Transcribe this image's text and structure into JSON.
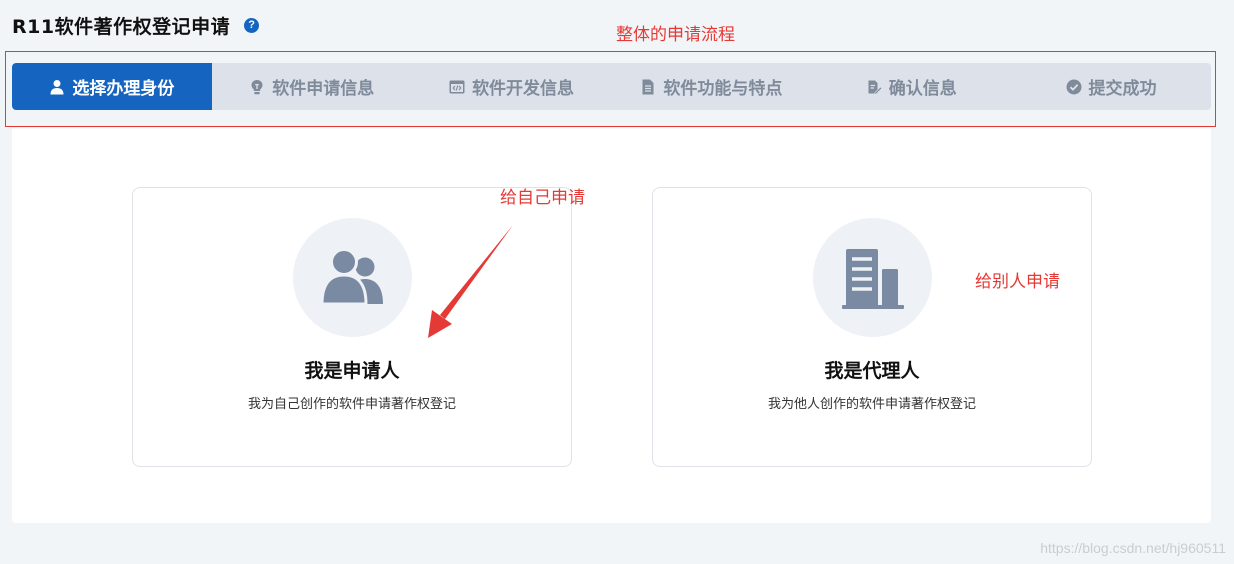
{
  "header": {
    "title": "R11软件著作权登记申请",
    "help_icon": "?"
  },
  "annotations": {
    "flow": "整体的申请流程",
    "self": "给自己申请",
    "other": "给别人申请"
  },
  "steps": [
    {
      "label": "选择办理身份",
      "icon": "user-icon",
      "active": true
    },
    {
      "label": "软件申请信息",
      "icon": "lightbulb-icon",
      "active": false
    },
    {
      "label": "软件开发信息",
      "icon": "code-window-icon",
      "active": false
    },
    {
      "label": "软件功能与特点",
      "icon": "document-icon",
      "active": false
    },
    {
      "label": "确认信息",
      "icon": "edit-document-icon",
      "active": false
    },
    {
      "label": "提交成功",
      "icon": "check-circle-icon",
      "active": false
    }
  ],
  "cards": {
    "applicant": {
      "title": "我是申请人",
      "desc": "我为自己创作的软件申请著作权登记",
      "icon": "users-icon"
    },
    "agent": {
      "title": "我是代理人",
      "desc": "我为他人创作的软件申请著作权登记",
      "icon": "building-icon"
    }
  },
  "watermark": "https://blog.csdn.net/hj960511",
  "colors": {
    "primary": "#1565c0",
    "annotation": "#e53935",
    "step_inactive_bg": "#dde2ea",
    "icon_gray": "#7a8aa3"
  }
}
